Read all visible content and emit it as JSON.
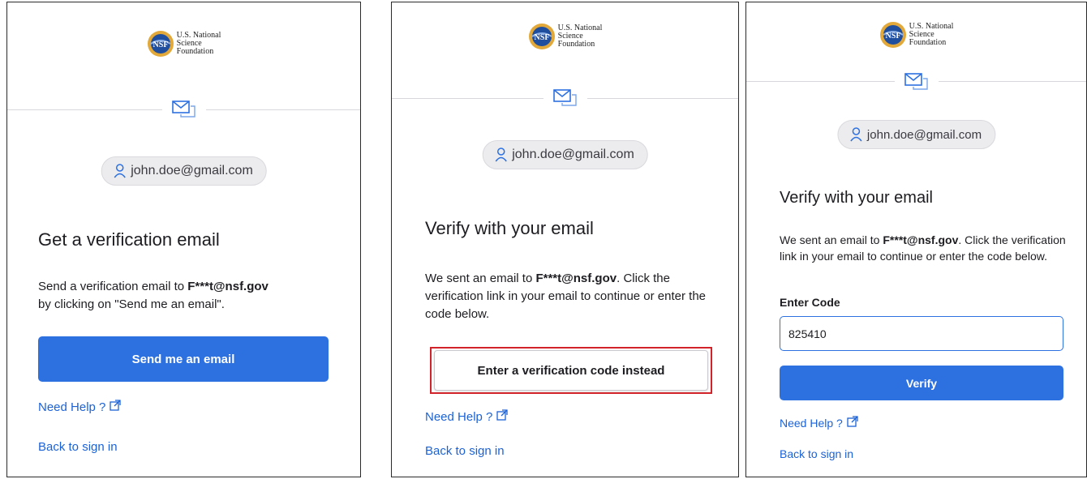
{
  "logo": {
    "seal_text": "NSF",
    "line1": "U.S. National",
    "line2": "Science",
    "line3": "Foundation"
  },
  "panels": [
    {
      "user_email": "john.doe@gmail.com",
      "title": "Get a verification email",
      "body_prefix": "Send a verification email to ",
      "body_email": "F***t@nsf.gov",
      "body_suffix": "by clicking on \"Send me an email\".",
      "primary_button": "Send me an email",
      "help_link": "Need Help ?",
      "back_link": "Back to sign in"
    },
    {
      "user_email": "john.doe@gmail.com",
      "title": "Verify with your email",
      "body_prefix": "We sent an email to ",
      "body_email": "F***t@nsf.gov",
      "body_suffix": ". Click the verification link in your email to continue or enter the code below.",
      "secondary_button": "Enter a verification code instead",
      "help_link": "Need Help ?",
      "back_link": "Back to sign in"
    },
    {
      "user_email": "john.doe@gmail.com",
      "title": "Verify with your email",
      "body_prefix": "We sent an email to ",
      "body_email": "F***t@nsf.gov",
      "body_suffix": ". Click the verification link in your email to continue or enter the code below.",
      "code_label": "Enter Code",
      "code_value": "825410",
      "primary_button": "Verify",
      "help_link": "Need Help ?",
      "back_link": "Back to sign in"
    }
  ],
  "colors": {
    "primary": "#2d71e1",
    "link": "#1b62d6",
    "highlight": "#d2232a",
    "chip_bg": "#ececee"
  },
  "icons": [
    "nsf-seal",
    "mail-icon",
    "user-icon",
    "external-link-icon"
  ]
}
